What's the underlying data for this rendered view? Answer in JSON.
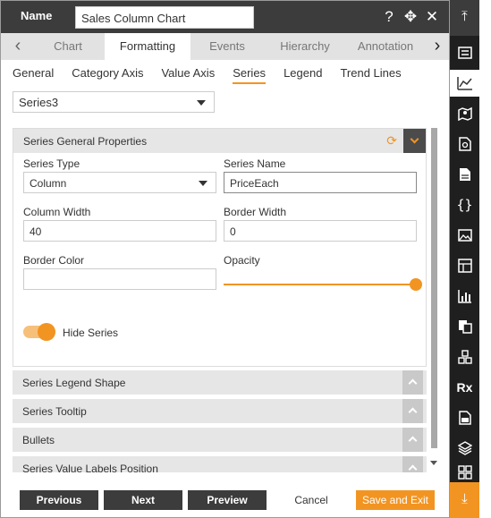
{
  "header": {
    "name_label": "Name",
    "name_value": "Sales Column Chart",
    "icons": [
      "help-icon",
      "move-icon",
      "close-icon"
    ]
  },
  "tabs": {
    "items": [
      {
        "label": "Chart"
      },
      {
        "label": "Formatting",
        "active": true
      },
      {
        "label": "Events"
      },
      {
        "label": "Hierarchy"
      },
      {
        "label": "Annotation"
      }
    ]
  },
  "subtabs": {
    "items": [
      {
        "label": "General"
      },
      {
        "label": "Category Axis"
      },
      {
        "label": "Value Axis"
      },
      {
        "label": "Series",
        "active": true
      },
      {
        "label": "Legend"
      },
      {
        "label": "Trend Lines"
      }
    ]
  },
  "series_select": {
    "value": "Series3"
  },
  "general_section": {
    "title": "Series General Properties",
    "series_type_label": "Series Type",
    "series_type_value": "Column",
    "series_name_label": "Series Name",
    "series_name_value": "PriceEach",
    "column_width_label": "Column Width",
    "column_width_value": "40",
    "border_width_label": "Border Width",
    "border_width_value": "0",
    "border_color_label": "Border Color",
    "border_color_value": "",
    "opacity_label": "Opacity",
    "opacity_value": 1.0,
    "hide_series_label": "Hide Series",
    "hide_series_on": true
  },
  "collapsed_sections": [
    {
      "label": "Series Legend Shape"
    },
    {
      "label": "Series Tooltip"
    },
    {
      "label": "Bullets"
    },
    {
      "label": "Series Value Labels Position"
    }
  ],
  "footer": {
    "previous": "Previous",
    "next": "Next",
    "preview": "Preview",
    "cancel": "Cancel",
    "save_exit": "Save and Exit"
  },
  "colors": {
    "accent": "#f29422",
    "header_bg": "#3c3c3c",
    "rail_bg": "#1f1f1f"
  },
  "rail": {
    "icons": [
      "collapse-top-icon",
      "list-icon",
      "chart-icon",
      "map-icon",
      "document-search-icon",
      "document-icon",
      "code-braces-icon",
      "image-icon",
      "dashboard-icon",
      "bar-chart-icon",
      "copy-icon",
      "cubes-icon",
      "rx-icon",
      "report-icon",
      "layers-icon",
      "grid-icon",
      "expand-down-icon"
    ],
    "rx_text": "Rx"
  }
}
